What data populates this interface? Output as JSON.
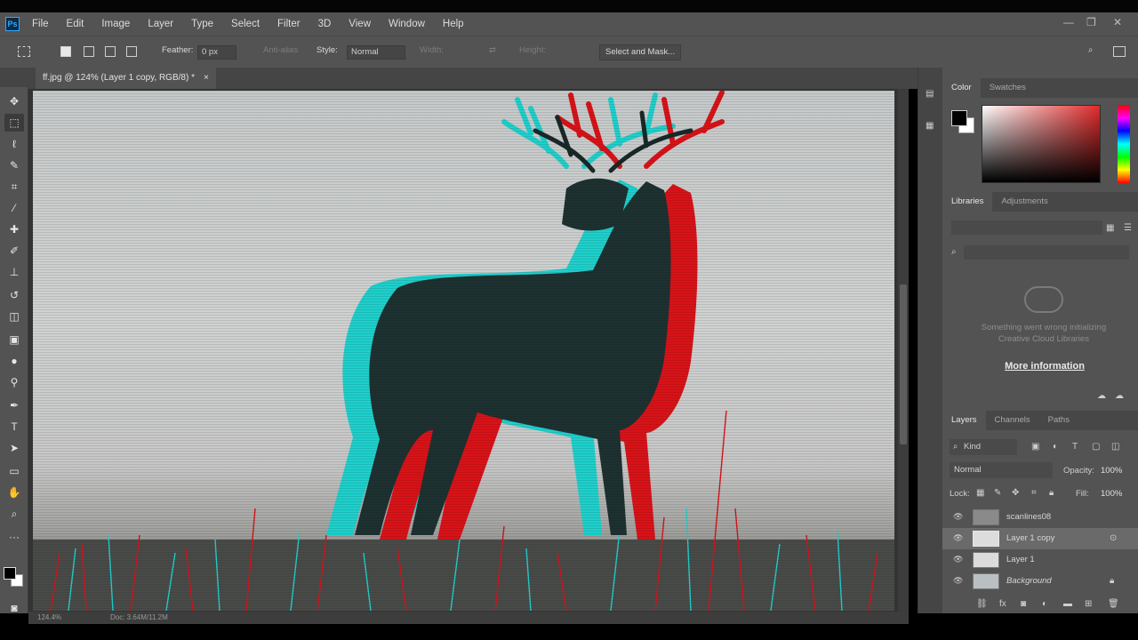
{
  "menu": {
    "logo": "Ps",
    "items": [
      "File",
      "Edit",
      "Image",
      "Layer",
      "Type",
      "Select",
      "Filter",
      "3D",
      "View",
      "Window",
      "Help"
    ]
  },
  "options": {
    "feather_label": "Feather:",
    "feather_value": "0 px",
    "antialias_label": "Anti-alias",
    "style_label": "Style:",
    "style_value": "Normal",
    "width_label": "Width:",
    "height_label": "Height:",
    "select_mask_label": "Select and Mask..."
  },
  "document": {
    "tab_title": "ff.jpg @ 124% (Layer 1 copy, RGB/8) *",
    "close": "×"
  },
  "status": {
    "zoom": "124.4%",
    "doc": "Doc: 3.64M/11.2M"
  },
  "panels": {
    "color_tabs": [
      "Color",
      "Swatches"
    ],
    "libraries_tabs": [
      "Libraries",
      "Adjustments"
    ],
    "libraries_message_line1": "Something went wrong initializing",
    "libraries_message_line2": "Creative Cloud Libraries",
    "libraries_more": "More information",
    "layers_tabs": [
      "Layers",
      "Channels",
      "Paths"
    ],
    "kind_label": "Kind",
    "blend_mode": "Normal",
    "opacity_label": "Opacity:",
    "opacity_value": "100%",
    "lock_label": "Lock:",
    "fill_label": "Fill:",
    "fill_value": "100%",
    "layers": [
      {
        "name": "scanlines08",
        "visible": true,
        "selected": false
      },
      {
        "name": "Layer 1 copy",
        "visible": true,
        "selected": true
      },
      {
        "name": "Layer 1",
        "visible": true,
        "selected": false
      },
      {
        "name": "Background",
        "visible": true,
        "selected": false,
        "locked": true
      }
    ]
  },
  "colors": {
    "ui_dark": "#535353",
    "ui_darker": "#454545",
    "anaglyph_red": "#e0141b",
    "anaglyph_cyan": "#22d8d4"
  }
}
